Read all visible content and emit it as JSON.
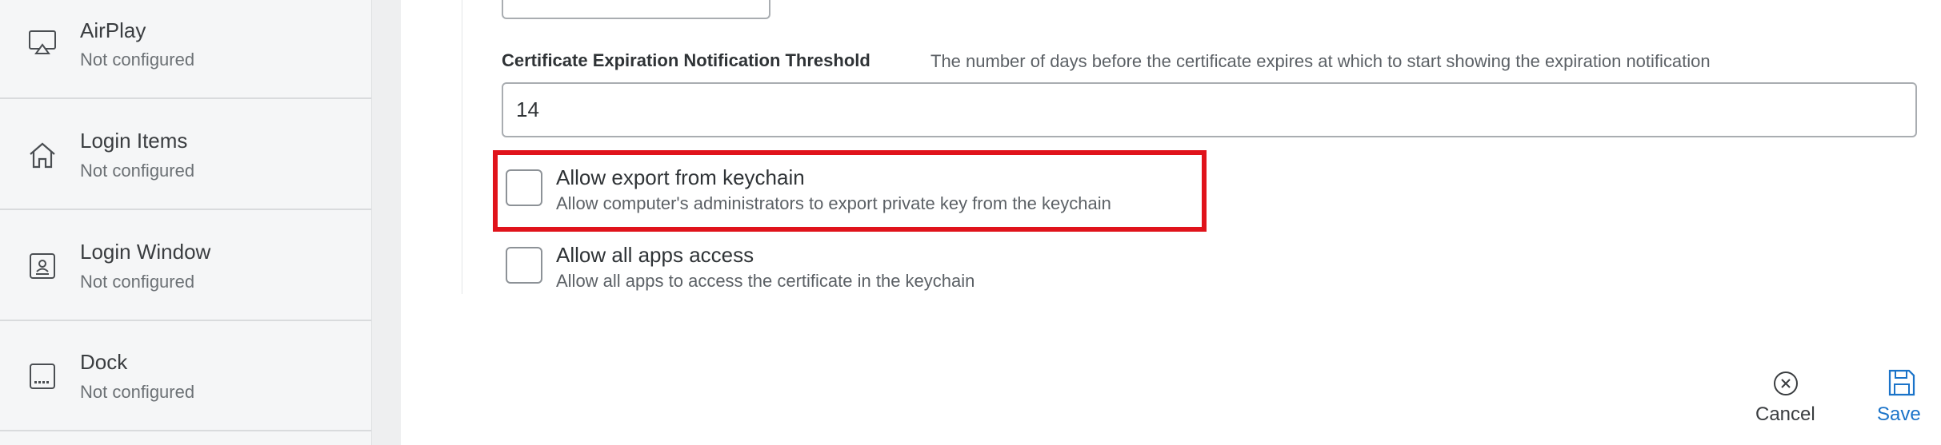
{
  "sidebar": {
    "items": [
      {
        "icon": "airplay-icon",
        "title": "AirPlay",
        "status": "Not configured"
      },
      {
        "icon": "home-icon",
        "title": "Login Items",
        "status": "Not configured"
      },
      {
        "icon": "login-window-icon",
        "title": "Login Window",
        "status": "Not configured"
      },
      {
        "icon": "dock-icon",
        "title": "Dock",
        "status": "Not configured"
      }
    ]
  },
  "form": {
    "threshold_label": "Certificate Expiration Notification Threshold",
    "threshold_description": "The number of days before the certificate expires at which to start showing the expiration notification",
    "threshold_value": "14",
    "checkboxes": [
      {
        "label": "Allow export from keychain",
        "description": "Allow computer's administrators to export private key from the keychain",
        "checked": false
      },
      {
        "label": "Allow all apps access",
        "description": "Allow all apps to access the certificate in the keychain",
        "checked": false
      }
    ]
  },
  "footer": {
    "cancel_label": "Cancel",
    "save_label": "Save"
  },
  "colors": {
    "highlight": "#e0131b",
    "save_accent": "#1a73c9"
  }
}
